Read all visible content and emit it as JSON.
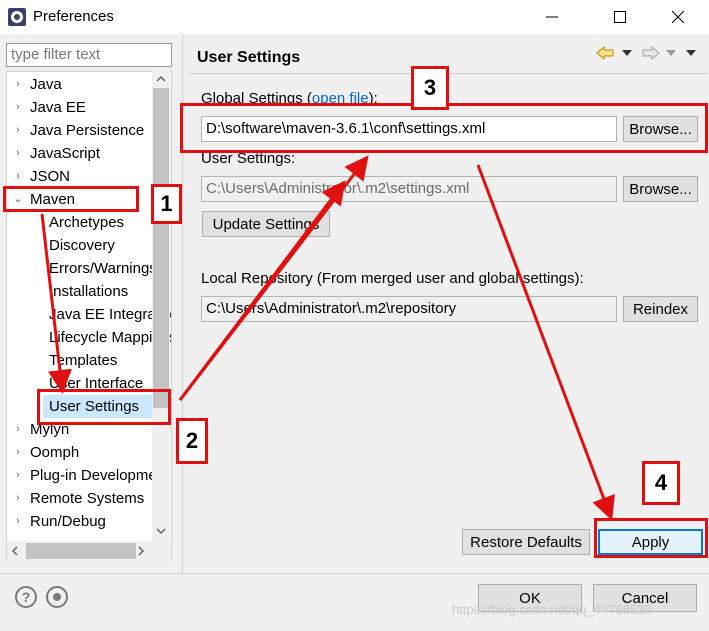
{
  "window": {
    "title": "Preferences"
  },
  "filter": {
    "placeholder": "type filter text"
  },
  "tree": [
    {
      "label": "Java",
      "twisty": "›"
    },
    {
      "label": "Java EE",
      "twisty": "›"
    },
    {
      "label": "Java Persistence",
      "twisty": "›"
    },
    {
      "label": "JavaScript",
      "twisty": "›"
    },
    {
      "label": "JSON",
      "twisty": "›"
    },
    {
      "label": "Maven",
      "twisty": "⌄"
    },
    {
      "label": "Archetypes"
    },
    {
      "label": "Discovery"
    },
    {
      "label": "Errors/Warnings"
    },
    {
      "label": "Installations"
    },
    {
      "label": "Java EE Integration"
    },
    {
      "label": "Lifecycle Mappings"
    },
    {
      "label": "Templates"
    },
    {
      "label": "User Interface"
    },
    {
      "label": "User Settings",
      "selected": true
    },
    {
      "label": "Mylyn",
      "twisty": "›"
    },
    {
      "label": "Oomph",
      "twisty": "›"
    },
    {
      "label": "Plug-in Development",
      "twisty": "›"
    },
    {
      "label": "Remote Systems",
      "twisty": "›"
    },
    {
      "label": "Run/Debug",
      "twisty": "›"
    }
  ],
  "page": {
    "title": "User Settings",
    "global_label": "Global Settings (",
    "global_link": "open file",
    "global_label_end": "):",
    "global_value": "D:\\software\\maven-3.6.1\\conf\\settings.xml",
    "browse_label": "Browse...",
    "user_label": "User Settings:",
    "user_value": "C:\\Users\\Administrator\\.m2\\settings.xml",
    "update_label": "Update Settings",
    "local_label": "Local Repository (From merged user and global settings):",
    "local_value": "C:\\Users\\Administrator\\.m2\\repository",
    "reindex_label": "Reindex"
  },
  "buttons": {
    "restore": "Restore Defaults",
    "apply": "Apply",
    "ok": "OK",
    "cancel": "Cancel"
  },
  "help": {
    "question": "?"
  },
  "annotations": {
    "n1": "1",
    "n2": "2",
    "n3": "3",
    "n4": "4"
  },
  "watermark": "https://blog.csdn.net/qq_44768530",
  "colors": {
    "annotation_red": "#e01010",
    "link_blue": "#0066cc",
    "apply_border": "#0078d7"
  }
}
